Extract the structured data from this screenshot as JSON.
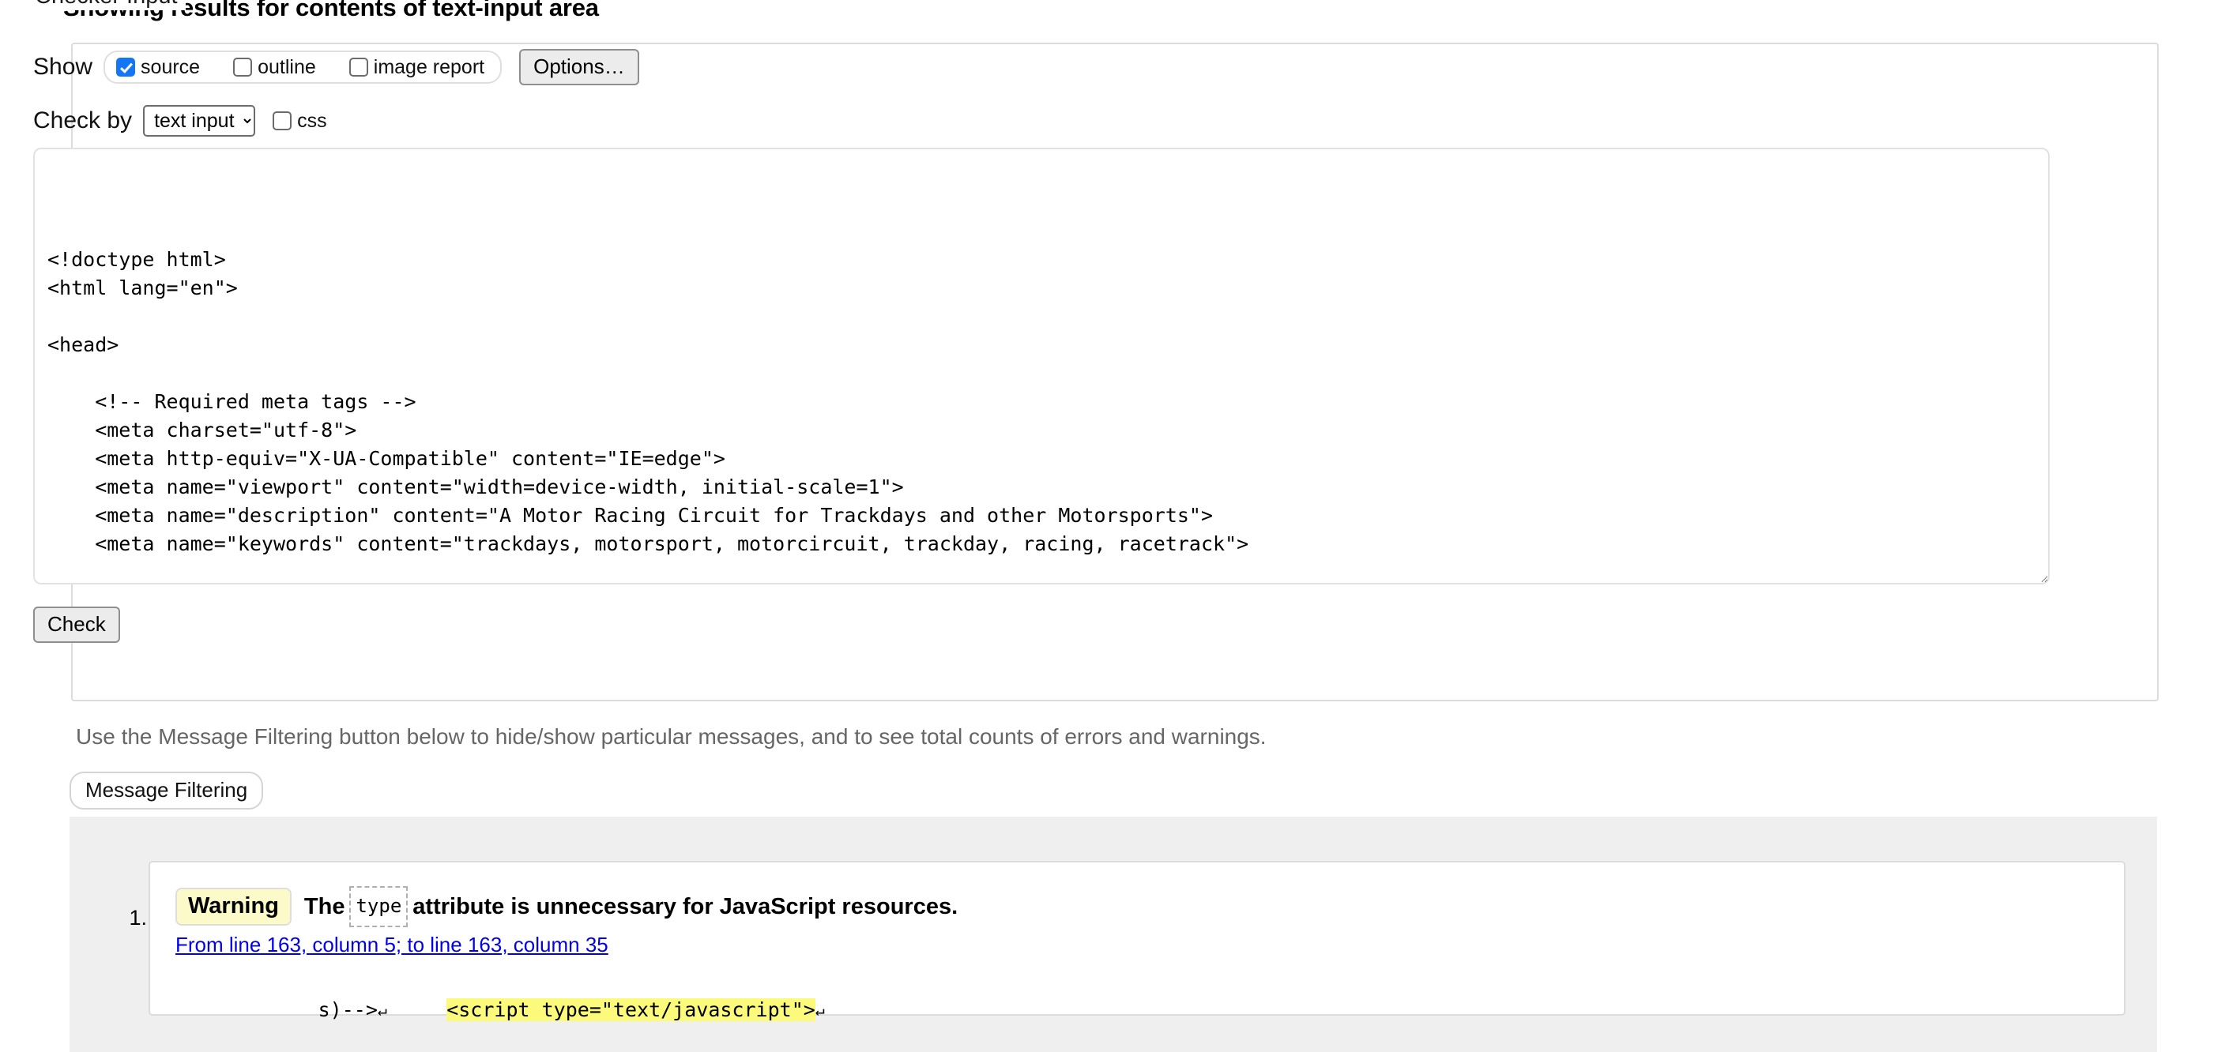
{
  "heading": "Showing results for contents of text-input area",
  "checker": {
    "legend": "Checker Input",
    "show": {
      "label": "Show",
      "checkboxes": [
        {
          "label": "source",
          "checked": true
        },
        {
          "label": "outline",
          "checked": false
        },
        {
          "label": "image report",
          "checked": false
        }
      ],
      "options_button": "Options…"
    },
    "check_by": {
      "label": "Check by",
      "selected": "text input",
      "options": [
        "text input"
      ],
      "css_checkbox": {
        "label": "css",
        "checked": false
      }
    },
    "source_text": "\n\n\n<!doctype html>\n<html lang=\"en\">\n\n<head>\n\n    <!-- Required meta tags -->\n    <meta charset=\"utf-8\">\n    <meta http-equiv=\"X-UA-Compatible\" content=\"IE=edge\">\n    <meta name=\"viewport\" content=\"width=device-width, initial-scale=1\">\n    <meta name=\"description\" content=\"A Motor Racing Circuit for Trackdays and other Motorsports\">\n    <meta name=\"keywords\" content=\"trackdays, motorsport, motorcircuit, trackday, racing, racetrack\">",
    "check_button": "Check"
  },
  "filtering": {
    "help_text": "Use the Message Filtering button below to hide/show particular messages, and to see total counts of errors and warnings.",
    "button_label": "Message Filtering"
  },
  "results": {
    "messages": [
      {
        "index": "1.",
        "badge": "Warning",
        "text_before": "The",
        "code": "type",
        "text_after": "attribute is unnecessary for JavaScript resources.",
        "location": "From line 163, column 5; to line 163, column 35",
        "extract_prefix": "s)-->",
        "extract_highlight": "<script type=\"text/javascript\">",
        "cr_glyph": "↵"
      }
    ]
  },
  "colors": {
    "accent_checkbox": "#1475f5",
    "warning_badge_bg": "#fcfac8",
    "highlight_bg": "#fcfa7a",
    "panel_bg": "#efefef",
    "link": "#0000ee"
  }
}
